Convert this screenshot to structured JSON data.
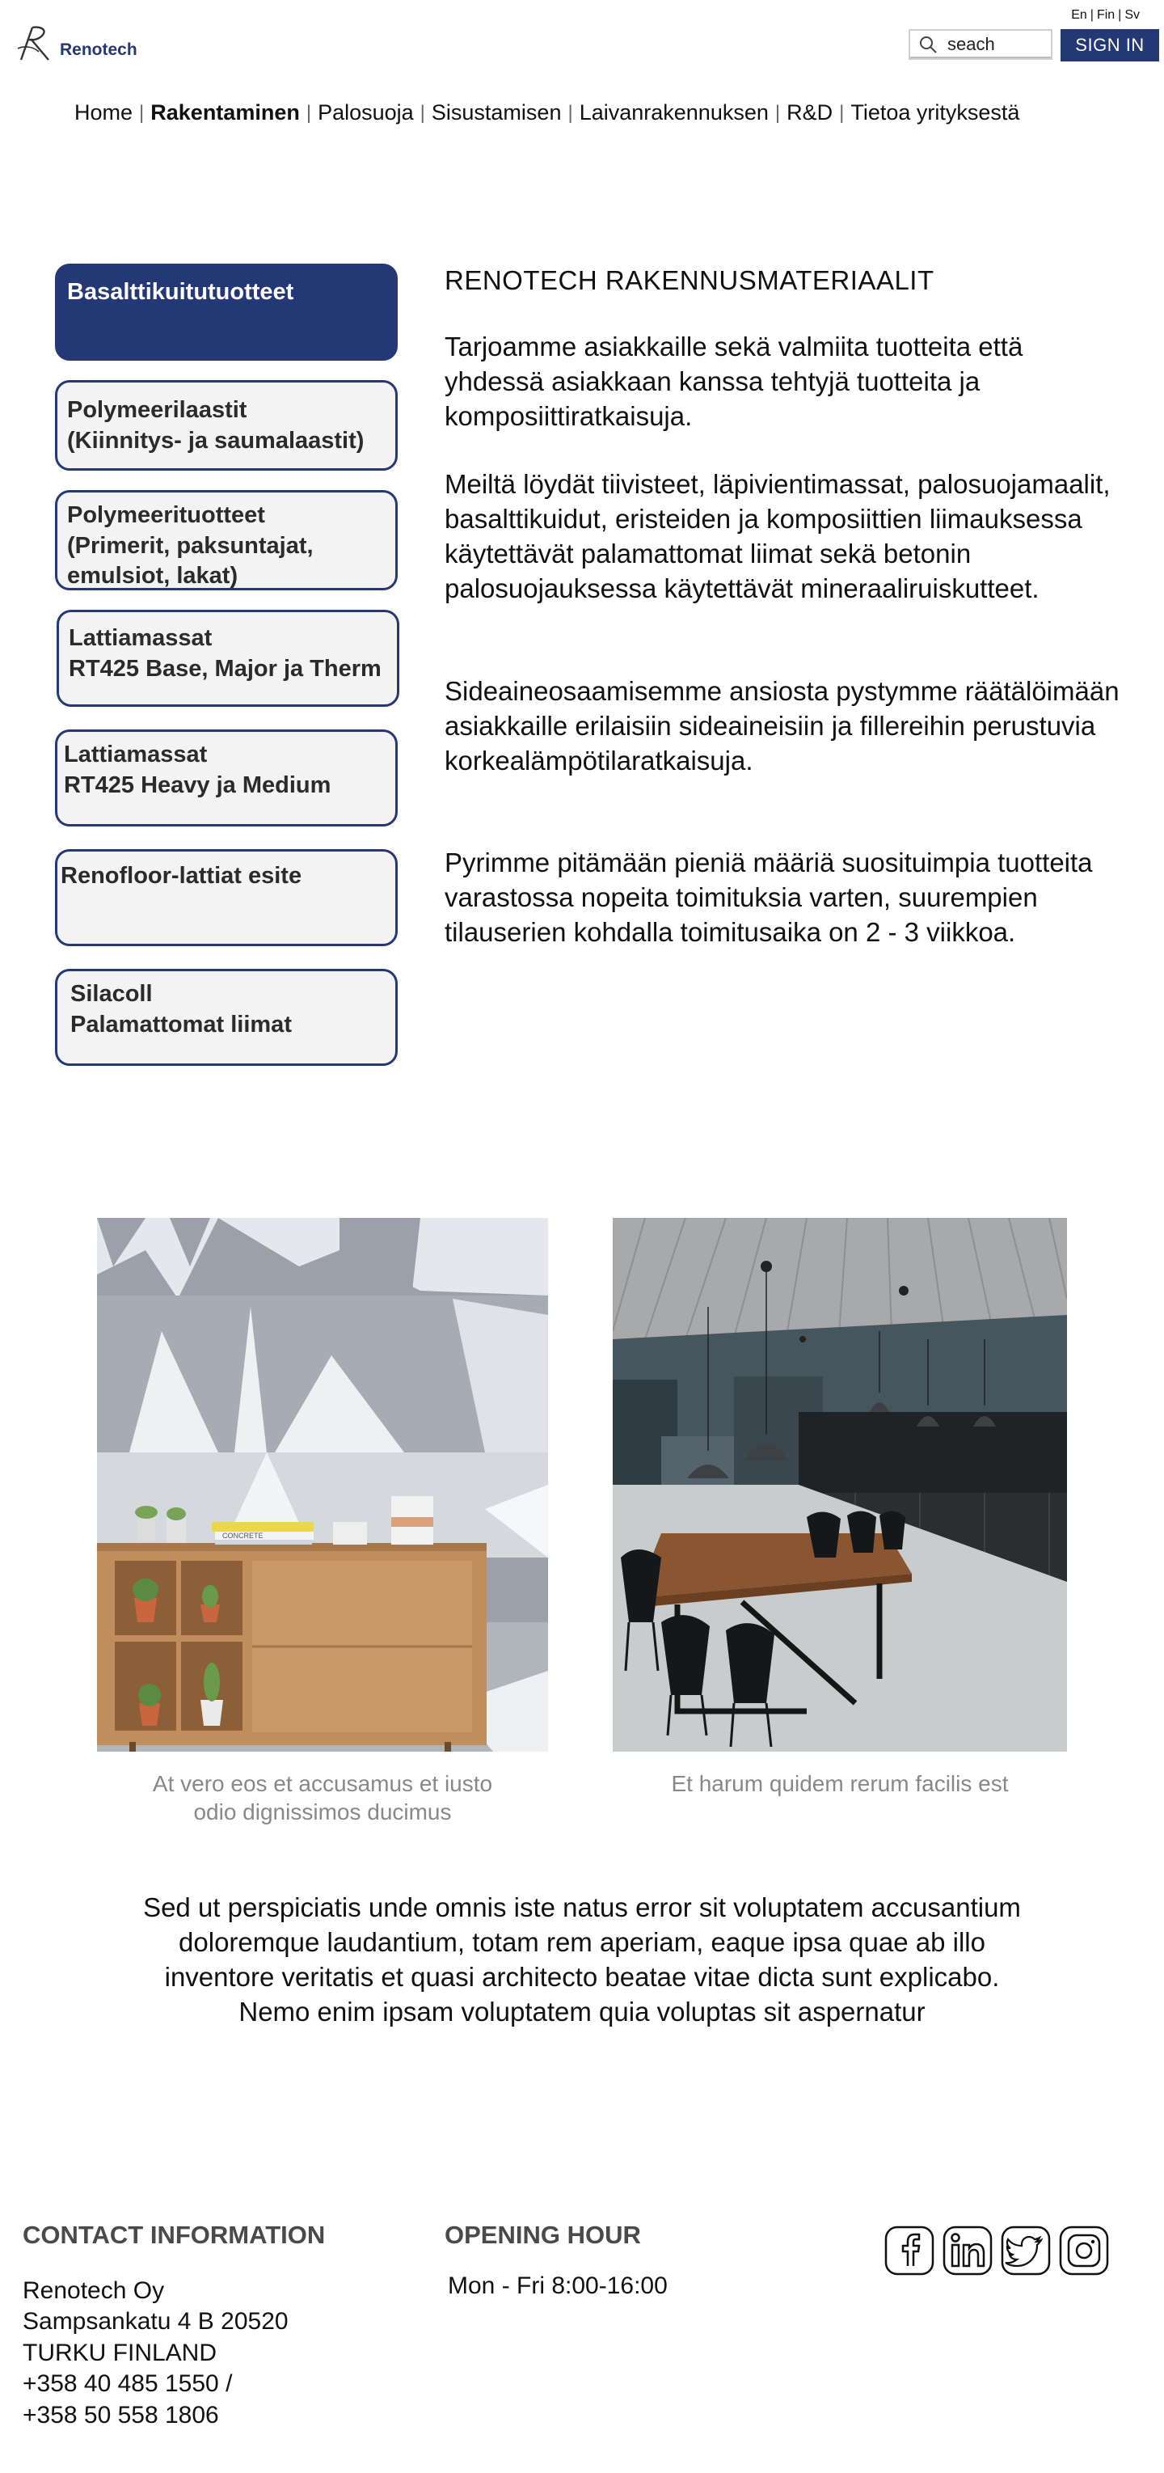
{
  "header": {
    "brand": "Renotech",
    "lang": [
      "En",
      "Fin",
      "Sv"
    ],
    "search_placeholder": "seach",
    "signin_label": "SIGN IN"
  },
  "nav": {
    "items": [
      "Home",
      "Rakentaminen",
      "Palosuoja",
      "Sisustamisen",
      "Laivanrakennuksen",
      "R&D",
      "Tietoa yrityksestä"
    ],
    "active": "Rakentaminen"
  },
  "sidebar": {
    "items": [
      {
        "line1": "Basalttikuitutuotteet",
        "line2": "",
        "line3": ""
      },
      {
        "line1": "Polymeerilaastit",
        "line2": "(Kiinnitys- ja saumalaastit)",
        "line3": ""
      },
      {
        "line1": "Polymeerituotteet",
        "line2": "(Primerit, paksuntajat,",
        "line3": "emulsiot, lakat)"
      },
      {
        "line1": "Lattiamassat",
        "line2": "RT425 Base, Major ja Therm",
        "line3": ""
      },
      {
        "line1": "Lattiamassat",
        "line2": "RT425 Heavy ja Medium",
        "line3": ""
      },
      {
        "line1": "Renofloor-lattiat esite",
        "line2": "",
        "line3": ""
      },
      {
        "line1": "Silacoll",
        "line2": "Palamattomat liimat",
        "line3": ""
      }
    ]
  },
  "main": {
    "title": "RENOTECH RAKENNUSMATERIAALIT",
    "p1": "Tarjoamme asiakkaille sekä valmiita tuotteita että yhdessä asiakkaan kanssa tehtyjä tuotteita ja komposiittiratkaisuja.",
    "p2": "Meiltä löydät tiivisteet, läpivientimassat, palosuojamaalit, basalttikuidut, eristeiden ja komposiittien liimauksessa käytettävät palamattomat liimat sekä betonin palosuojauksessa käytettävät mineraaliruiskutteet.",
    "p3": "Sideaineosaamisemme ansiosta pystymme räätälöimään asiakkaille erilaisiin sideaineisiin ja fillereihin perustuvia korkealämpötilaratkaisuja.",
    "p4": "Pyrimme pitämään pieniä määriä suosituimpia tuotteita varastossa nopeita toimituksia varten, suurempien tilauserien kohdalla toimitusaika on 2 - 3  viikkoa."
  },
  "gallery": {
    "caption1_line1": "At vero eos et accusamus et iusto",
    "caption1_line2": "odio dignissimos ducimus",
    "caption2": "Et harum quidem rerum facilis est",
    "book_text": "CONCRETE"
  },
  "quote": {
    "line1": "Sed ut perspiciatis unde omnis iste natus error sit voluptatem accusantium",
    "line2": "doloremque laudantium, totam rem aperiam, eaque ipsa quae ab illo",
    "line3": "inventore veritatis et quasi architecto beatae vitae dicta sunt explicabo.",
    "line4": "Nemo enim ipsam voluptatem quia voluptas sit aspernatur"
  },
  "footer": {
    "contact_heading": "CONTACT INFORMATION",
    "company": "Renotech Oy",
    "address1": "Sampsankatu 4 B 20520",
    "address2": "TURKU FINLAND",
    "phone1": "+358 40 485 1550 /",
    "phone2": "+358 50 558 1806",
    "hours_heading": "OPENING HOUR",
    "hours": "Mon - Fri  8:00-16:00",
    "social": [
      "facebook-icon",
      "linkedin-icon",
      "twitter-icon",
      "instagram-icon"
    ]
  },
  "colors": {
    "brand": "#253876",
    "sidebar_bg": "#f3f3f3"
  }
}
